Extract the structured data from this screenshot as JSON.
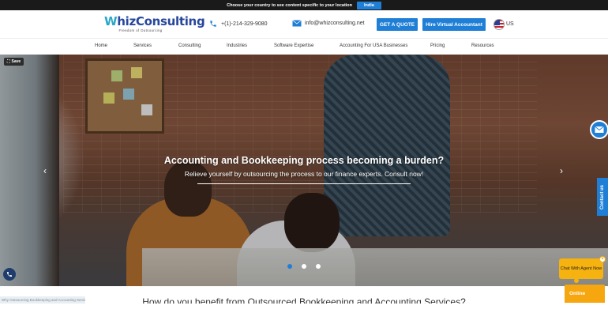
{
  "country_bar": {
    "text": "Choose your country to see content specific to your location",
    "button": "India"
  },
  "header": {
    "logo": {
      "name_first": "W",
      "name_rest": "hiz",
      "name_second": "Consulting",
      "tagline": "Freedom of Outsourcing"
    },
    "phone": "+(1)-214-329-9080",
    "email": "info@whizconsulting.net",
    "quote_button": "GET A QUOTE",
    "hire_button": "Hire Virtual Accountant",
    "region": "US"
  },
  "nav": {
    "items": [
      "Home",
      "Services",
      "Consulting",
      "Industries",
      "Software Expertise",
      "Accounting For USA Businesses",
      "Pricing",
      "Resources"
    ]
  },
  "hero": {
    "save_label": "Save",
    "title": "Accounting and Bookkeeping process becoming a burden?",
    "subtitle": "Relieve yourself by outsourcing the process to our finance experts. Consult now!",
    "slides": 3,
    "active_slide": 1
  },
  "side": {
    "contact_tab": "Contact us"
  },
  "bottom": {
    "image_caption": "Why Outsourcing Bookkeeping and Accounting Services",
    "section_heading": "How do you benefit from Outsourced Bookkeeping and Accounting Services?"
  },
  "chat": {
    "prompt": "Chat With Agent Now",
    "close": "×",
    "status": "Online"
  },
  "colors": {
    "accent": "#1f7fd6",
    "chat": "#f6b20e"
  }
}
